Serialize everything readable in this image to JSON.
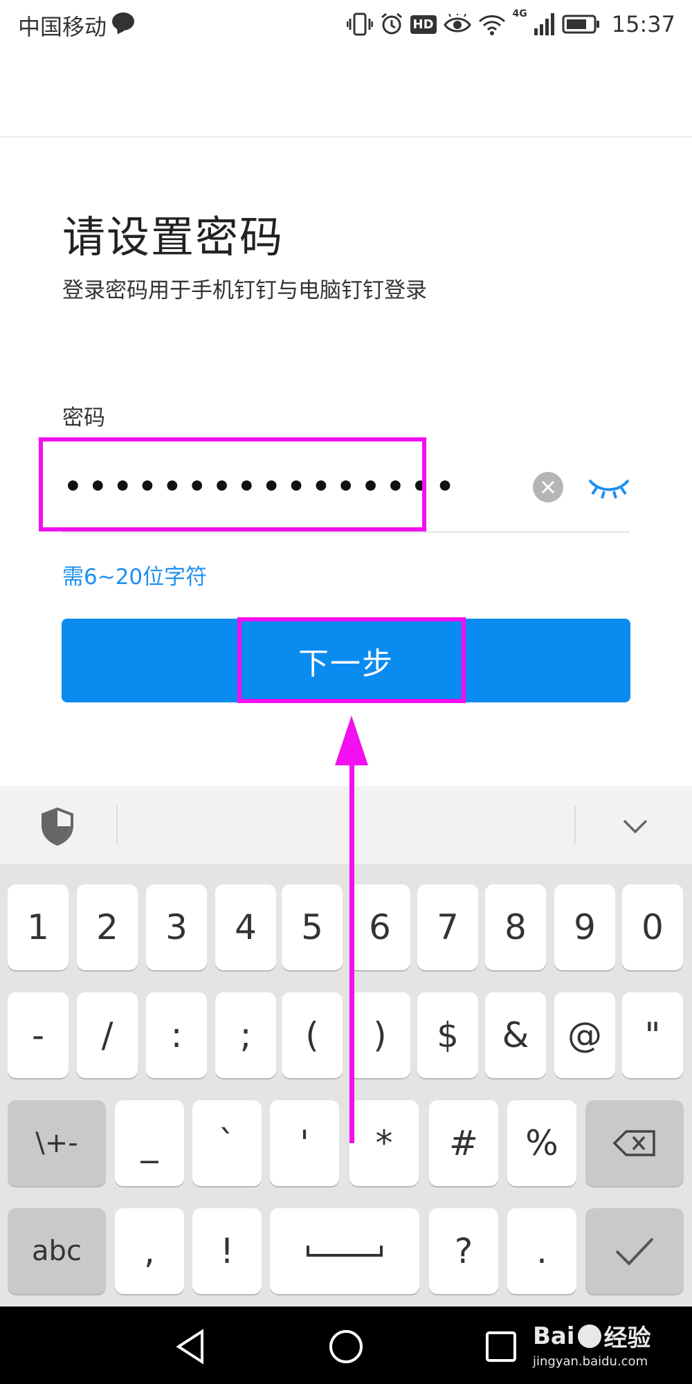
{
  "status_bar": {
    "carrier": "中国移动",
    "network": "4G",
    "hd_badge": "HD",
    "time": "15:37",
    "icons": [
      "message-icon",
      "vibrate-icon",
      "alarm-icon",
      "hd-icon",
      "eye-comfort-icon",
      "wifi-icon",
      "signal-icon",
      "battery-icon"
    ]
  },
  "page": {
    "title": "请设置密码",
    "subtitle": "登录密码用于手机钉钉与电脑钉钉登录",
    "password_label": "密码",
    "password_value": "••••••••••••••••",
    "hint": "需6~20位字符",
    "next_button": "下一步"
  },
  "keyboard": {
    "toolbar_icons": [
      "shield-icon",
      "collapse-keyboard-icon"
    ],
    "row1": [
      "1",
      "2",
      "3",
      "4",
      "5",
      "6",
      "7",
      "8",
      "9",
      "0"
    ],
    "row2": [
      "-",
      "/",
      ":",
      ";",
      "(",
      ")",
      "$",
      "&",
      "@",
      "\""
    ],
    "row3": [
      "\\+-",
      "_",
      "`",
      "'",
      "*",
      "#",
      "%"
    ],
    "row4": [
      "abc",
      ",",
      "!",
      "?",
      "."
    ],
    "special_keys": [
      "space-key",
      "backspace-key",
      "enter-key"
    ]
  },
  "watermark": {
    "brand": "Bai",
    "brand2": "经验",
    "url": "jingyan.baidu.com"
  },
  "colors": {
    "accent": "#0a8bf0",
    "hint": "#1f8ff0",
    "annotation": "#f20ff0"
  }
}
